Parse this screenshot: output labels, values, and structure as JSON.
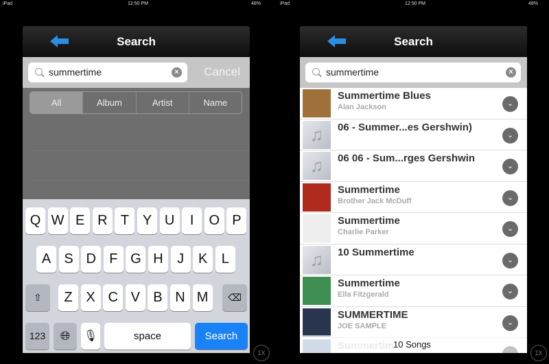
{
  "status": {
    "device": "iPad",
    "time": "12:50 PM",
    "battery": "48%"
  },
  "left": {
    "title": "Search",
    "query": "summertime",
    "cancel": "Cancel",
    "segments": [
      "All",
      "Album",
      "Artist",
      "Name"
    ],
    "selected_segment": "All",
    "keyboard": {
      "row1": [
        "Q",
        "W",
        "E",
        "R",
        "T",
        "Y",
        "U",
        "I",
        "O",
        "P"
      ],
      "row2": [
        "A",
        "S",
        "D",
        "F",
        "G",
        "H",
        "J",
        "K",
        "L"
      ],
      "row3": [
        "Z",
        "X",
        "C",
        "V",
        "B",
        "N",
        "M"
      ],
      "numbers": "123",
      "space": "space",
      "search": "Search"
    }
  },
  "right": {
    "title": "Search",
    "query": "summertime",
    "results": [
      {
        "title": "Summertime Blues",
        "subtitle": "Alan Jackson",
        "art": "#a0703a"
      },
      {
        "title": "06 - Summer...es Gershwin)",
        "subtitle": "",
        "art": "generic"
      },
      {
        "title": "06 06 - Sum...rges Gershwin",
        "subtitle": "",
        "art": "generic"
      },
      {
        "title": "Summertime",
        "subtitle": "Brother Jack McDuff",
        "art": "#b02a1e"
      },
      {
        "title": "Summertime",
        "subtitle": "Charlie Parker",
        "art": "#eeeeee"
      },
      {
        "title": "10 Summertime",
        "subtitle": "",
        "art": "generic"
      },
      {
        "title": "Summertime",
        "subtitle": "Ella Fitzgerald",
        "art": "#3f8f52"
      },
      {
        "title": "SUMMERTIME",
        "subtitle": "JOE SAMPLE",
        "art": "#2a3550"
      },
      {
        "title": "Summertim",
        "subtitle": "",
        "art": "#8fa8c8"
      }
    ],
    "count": "10 Songs"
  },
  "zoom_label": "1X",
  "colors": {
    "accent": "#2a8fe0",
    "search_key": "#1a82f7"
  }
}
